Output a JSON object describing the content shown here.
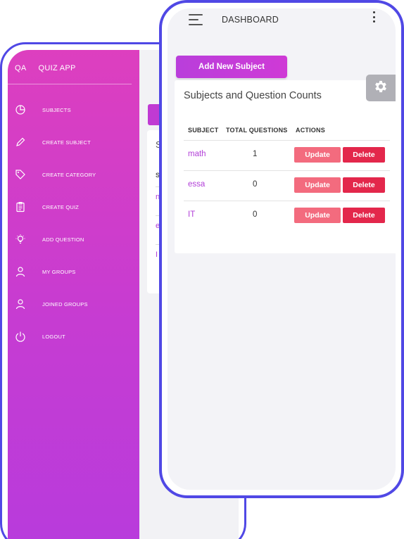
{
  "back_app": {
    "logo": "QA",
    "name": "QUIZ APP",
    "menu": [
      {
        "label": "SUBJECTS",
        "icon": "pie-chart-icon"
      },
      {
        "label": "CREATE SUBJECT",
        "icon": "pencil-icon"
      },
      {
        "label": "CREATE CATEGORY",
        "icon": "tag-icon"
      },
      {
        "label": "CREATE QUIZ",
        "icon": "clipboard-icon"
      },
      {
        "label": "ADD QUESTION",
        "icon": "lightbulb-icon"
      },
      {
        "label": "MY GROUPS",
        "icon": "user-icon"
      },
      {
        "label": "JOINED GROUPS",
        "icon": "user-icon"
      },
      {
        "label": "LOGOUT",
        "icon": "power-icon"
      }
    ],
    "card_fragments": [
      "Su",
      "S",
      "n",
      "e",
      "I"
    ]
  },
  "front_app": {
    "header": {
      "title": "DASHBOARD"
    },
    "add_button": "Add New Subject",
    "table": {
      "title": "Subjects and Question Counts",
      "columns": [
        "SUBJECT",
        "TOTAL QUESTIONS",
        "ACTIONS"
      ],
      "rows": [
        {
          "subject": "math",
          "count": "1",
          "update": "Update",
          "delete": "Delete"
        },
        {
          "subject": "essa",
          "count": "0",
          "update": "Update",
          "delete": "Delete"
        },
        {
          "subject": "IT",
          "count": "0",
          "update": "Update",
          "delete": "Delete"
        }
      ]
    }
  },
  "colors": {
    "frame": "#5048e5",
    "sidebar_top": "#dd3fbf",
    "sidebar_bottom": "#b83bdc",
    "update_button": "#f36b7e",
    "delete_button": "#e3274b",
    "subject_link": "#b23fd8"
  }
}
